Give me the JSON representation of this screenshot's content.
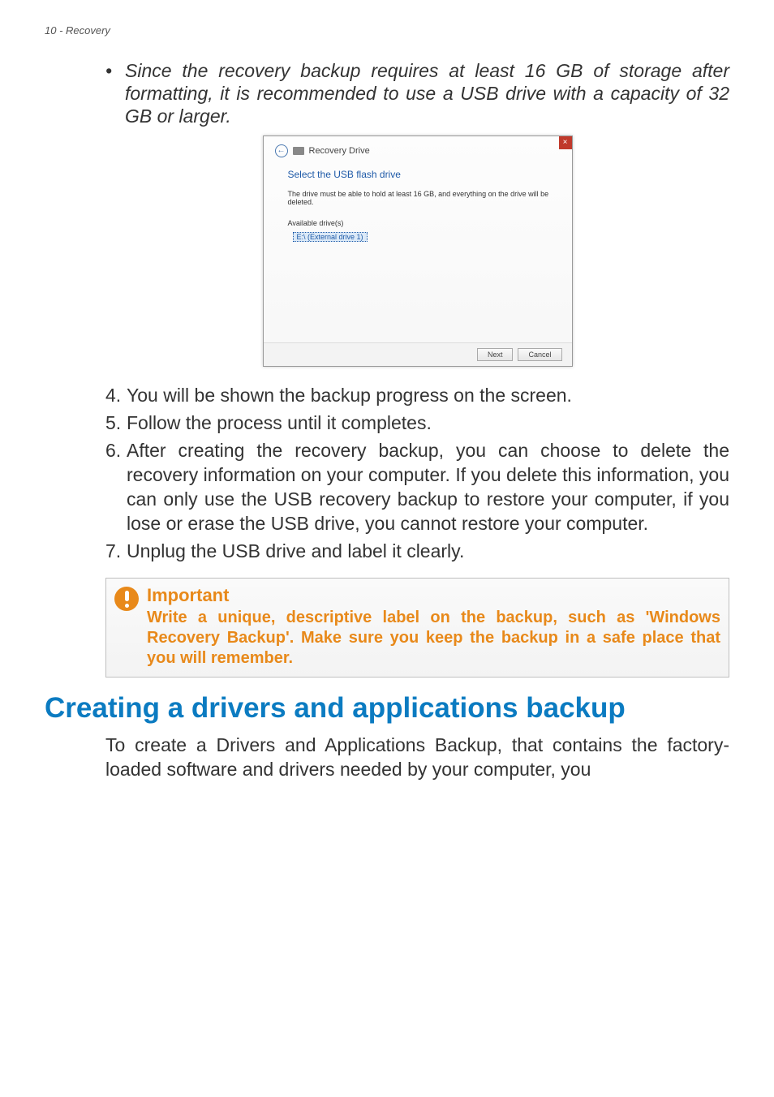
{
  "header": {
    "text": "10 - Recovery"
  },
  "bullet": {
    "marker": "•",
    "text": "Since the recovery backup requires at least 16 GB of storage after formatting, it is recommended to use a USB drive with a capacity of 32 GB or larger."
  },
  "screenshot": {
    "close": "×",
    "back_arrow": "←",
    "title": "Recovery Drive",
    "heading": "Select the USB flash drive",
    "note": "The drive must be able to hold at least 16 GB, and everything on the drive will be deleted.",
    "avail_label": "Available drive(s)",
    "selected_drive": "E:\\ (External drive 1)",
    "next": "Next",
    "cancel": "Cancel"
  },
  "steps": [
    {
      "num": "4.",
      "text": "You will be shown the backup progress on the screen."
    },
    {
      "num": "5.",
      "text": "Follow the process until it completes."
    },
    {
      "num": "6.",
      "text": "After creating the recovery backup, you can choose to delete the recovery information on your computer. If you delete this information, you can only use the USB recovery backup to restore your computer, if you lose or erase the USB drive, you cannot restore your computer."
    },
    {
      "num": "7.",
      "text": "Unplug the USB drive and label it clearly."
    }
  ],
  "callout": {
    "heading": "Important",
    "text": "Write a unique, descriptive label on the backup, such as 'Windows Recovery Backup'. Make sure you keep the backup in a safe place that you will remember."
  },
  "section": {
    "title": "Creating a drivers and applications backup",
    "para": "To create a Drivers and Applications Backup, that contains the factory-loaded software and drivers needed by your computer, you"
  }
}
